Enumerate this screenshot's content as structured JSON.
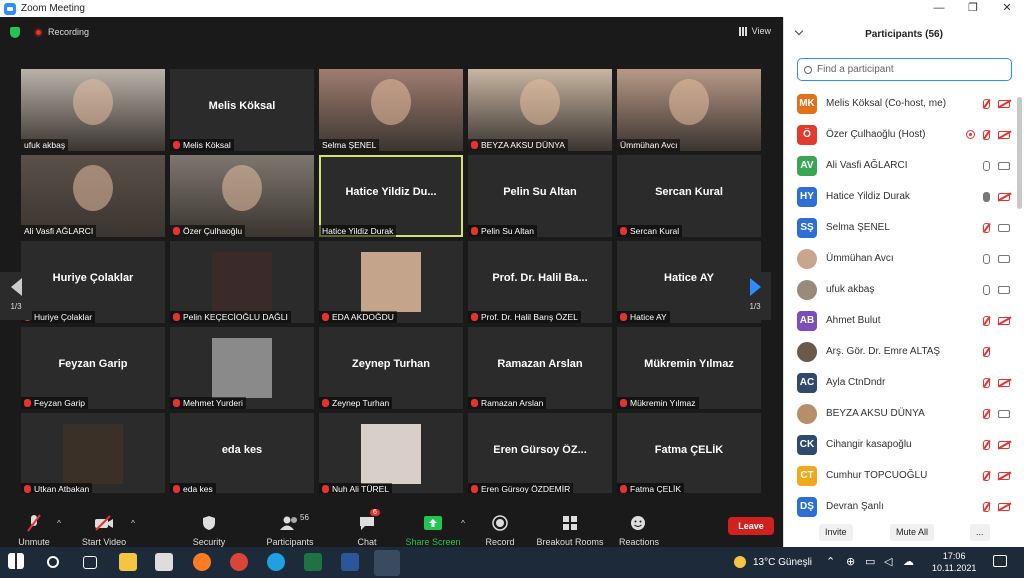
{
  "window": {
    "title": "Zoom Meeting"
  },
  "topbar": {
    "recording": "Recording",
    "view": "View"
  },
  "nav": {
    "left_page": "1/3",
    "right_page": "1/3"
  },
  "tiles": [
    {
      "label": "ufuk akbaş",
      "name": "",
      "muted": false,
      "photo": "#b9b3aa"
    },
    {
      "label": "Melis Köksal",
      "name": "Melis Köksal",
      "muted": true
    },
    {
      "label": "Selma ŞENEL",
      "name": "",
      "muted": false,
      "photo": "#a07d70"
    },
    {
      "label": "BEYZA AKSU DÜNYA",
      "name": "",
      "muted": true,
      "photo": "#c8b6a2"
    },
    {
      "label": "Ümmühan Avcı",
      "name": "",
      "muted": false,
      "photo": "#b99986"
    },
    {
      "label": "Ali Vasfi AĞLARCI",
      "name": "",
      "muted": false,
      "photo": "#5a5048"
    },
    {
      "label": "Özer Çulhaoğlu",
      "name": "",
      "muted": true,
      "photo": "#7d776f"
    },
    {
      "label": "Hatice Yildiz Durak",
      "name": "Hatice Yildiz Du...",
      "muted": false,
      "active": true
    },
    {
      "label": "Pelin Su Altan",
      "name": "Pelin Su Altan",
      "muted": true
    },
    {
      "label": "Sercan Kural",
      "name": "Sercan Kural",
      "muted": true
    },
    {
      "label": "Huriye Çolaklar",
      "name": "Huriye Çolaklar",
      "muted": true
    },
    {
      "label": "Pelin KEÇECİOĞLU DAĞLI",
      "name": "",
      "muted": true,
      "inset": "#3a2a2a"
    },
    {
      "label": "EDA AKDOĞDU",
      "name": "",
      "muted": true,
      "inset": "#c4a48b"
    },
    {
      "label": "Prof. Dr. Halil Barış ÖZEL",
      "name": "Prof. Dr. Halil Ba...",
      "muted": true
    },
    {
      "label": "Hatice AY",
      "name": "Hatice AY",
      "muted": true
    },
    {
      "label": "Feyzan Garip",
      "name": "Feyzan Garip",
      "muted": true
    },
    {
      "label": "Mehmet Yurderi",
      "name": "",
      "muted": true,
      "inset": "#8a8a8a"
    },
    {
      "label": "Zeynep Turhan",
      "name": "Zeynep Turhan",
      "muted": true
    },
    {
      "label": "Ramazan Arslan",
      "name": "Ramazan Arslan",
      "muted": true
    },
    {
      "label": "Mükremin Yılmaz",
      "name": "Mükremin Yılmaz",
      "muted": true
    },
    {
      "label": "Utkan Atbakan",
      "name": "",
      "muted": true,
      "inset": "#3b3028"
    },
    {
      "label": "eda kes",
      "name": "eda kes",
      "muted": true
    },
    {
      "label": "Nuh Ali TÜREL",
      "name": "",
      "muted": true,
      "inset": "#d8d0c8"
    },
    {
      "label": "Eren Gürsoy ÖZDEMİR",
      "name": "Eren Gürsoy ÖZ...",
      "muted": true
    },
    {
      "label": "Fatma ÇELİK",
      "name": "Fatma ÇELİK",
      "muted": true
    }
  ],
  "toolbar": {
    "unmute": "Unmute",
    "start_video": "Start Video",
    "security": "Security",
    "participants": "Participants",
    "participants_count": "56",
    "chat": "Chat",
    "chat_badge": "6",
    "share_screen": "Share Screen",
    "record": "Record",
    "breakout": "Breakout Rooms",
    "reactions": "Reactions",
    "leave": "Leave"
  },
  "panel": {
    "title": "Participants (56)",
    "search_placeholder": "Find a participant",
    "invite": "Invite",
    "mute_all": "Mute All",
    "more": "...",
    "participants": [
      {
        "initials": "MK",
        "color": "#e2711d",
        "name": "Melis Köksal (Co-host, me)",
        "mic": "off",
        "cam": "off"
      },
      {
        "initials": "Ö",
        "color": "#e23b2e",
        "name": "Özer Çulhaoğlu (Host)",
        "mic": "off",
        "cam": "off",
        "rec": true
      },
      {
        "initials": "AV",
        "color": "#3aa655",
        "name": "Ali Vasfi AĞLARCI",
        "mic": "idle",
        "cam": "on"
      },
      {
        "initials": "HY",
        "color": "#2d6fd6",
        "name": "Hatice Yildiz Durak",
        "mic": "on",
        "cam": "off"
      },
      {
        "initials": "SŞ",
        "color": "#2d6fd6",
        "name": "Selma ŞENEL",
        "mic": "off",
        "cam": "on"
      },
      {
        "initials": "",
        "color": "#c9a58d",
        "name": "Ümmühan Avcı",
        "mic": "idle",
        "cam": "on"
      },
      {
        "initials": "",
        "color": "#9a8a7a",
        "name": "ufuk akbaş",
        "mic": "idle",
        "cam": "on"
      },
      {
        "initials": "AB",
        "color": "#7c4dbd",
        "name": "Ahmet Bulut",
        "mic": "off",
        "cam": "off"
      },
      {
        "initials": "",
        "color": "#6b5a4a",
        "name": "Arş. Gör. Dr. Emre ALTAŞ",
        "mic": "off",
        "cam": "none"
      },
      {
        "initials": "AC",
        "color": "#2f4a6e",
        "name": "Ayla CtnDndr",
        "mic": "off",
        "cam": "off"
      },
      {
        "initials": "",
        "color": "#b88d6a",
        "name": "BEYZA AKSU DÜNYA",
        "mic": "off",
        "cam": "on"
      },
      {
        "initials": "CK",
        "color": "#2f4a6e",
        "name": "Cihangir kasapoğlu",
        "mic": "off",
        "cam": "off"
      },
      {
        "initials": "CT",
        "color": "#f2a81d",
        "name": "Cumhur TOPCUOĞLU",
        "mic": "off",
        "cam": "off"
      },
      {
        "initials": "DŞ",
        "color": "#2d6fd6",
        "name": "Devran Şanlı",
        "mic": "off",
        "cam": "off"
      }
    ]
  },
  "taskbar": {
    "weather": "13°C Güneşli",
    "time": "17:06",
    "date": "10.11.2021"
  }
}
